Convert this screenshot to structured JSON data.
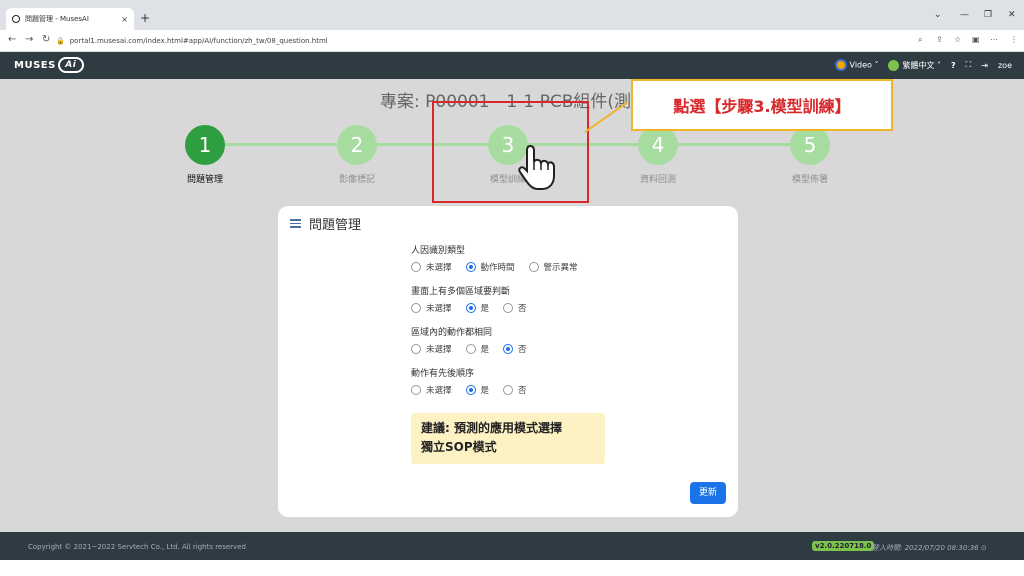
{
  "browser": {
    "tab_title": "問題管理 - MusesAI",
    "tab_close": "×",
    "new_tab": "+",
    "url": "portal1.musesai.com/index.html#app/AI/function/zh_tw/08_question.html"
  },
  "header": {
    "logo_text": "MUSES",
    "logo_ai": "Ai",
    "video_label": "Video ˅",
    "language_label": "繁體中文 ˅",
    "help_icon": "?",
    "user": "zoe"
  },
  "project": {
    "title": "專案: P00001 - 1-1 PCB組件(測試)"
  },
  "steps": [
    {
      "number": "1",
      "label": "問題管理",
      "active": true
    },
    {
      "number": "2",
      "label": "影像標記",
      "active": false
    },
    {
      "number": "3",
      "label": "模型訓練",
      "active": false
    },
    {
      "number": "4",
      "label": "資料回測",
      "active": false
    },
    {
      "number": "5",
      "label": "模型佈署",
      "active": false
    }
  ],
  "annotation": {
    "callout": "點選【步驟3.模型訓練】",
    "highlight_color": "#d9282c",
    "callout_border": "#f0b429"
  },
  "card": {
    "title": "問題管理",
    "questions": [
      {
        "label": "人因識別類型",
        "options": [
          "未選擇",
          "動作時間",
          "警示異常"
        ],
        "selected": 1
      },
      {
        "label": "畫面上有多個區域要判斷",
        "options": [
          "未選擇",
          "是",
          "否"
        ],
        "selected": 1
      },
      {
        "label": "區域內的動作都相同",
        "options": [
          "未選擇",
          "是",
          "否"
        ],
        "selected": 2
      },
      {
        "label": "動作有先後順序",
        "options": [
          "未選擇",
          "是",
          "否"
        ],
        "selected": 1
      }
    ],
    "suggestion_line1": "建議: 預測的應用模式選擇",
    "suggestion_line2": "獨立SOP模式",
    "update_button": "更新"
  },
  "footer": {
    "copyright": "Copyright © 2021~2022 Servtech Co., Ltd. All rights reserved",
    "version": "v2.0.220718.0",
    "login_time": "登入時間: 2022/07/20 08:30:36"
  },
  "colors": {
    "header_bg": "#2e3b43",
    "step_active": "#2f9e41",
    "step_inactive": "#a7dca0",
    "primary": "#1a73e8"
  }
}
